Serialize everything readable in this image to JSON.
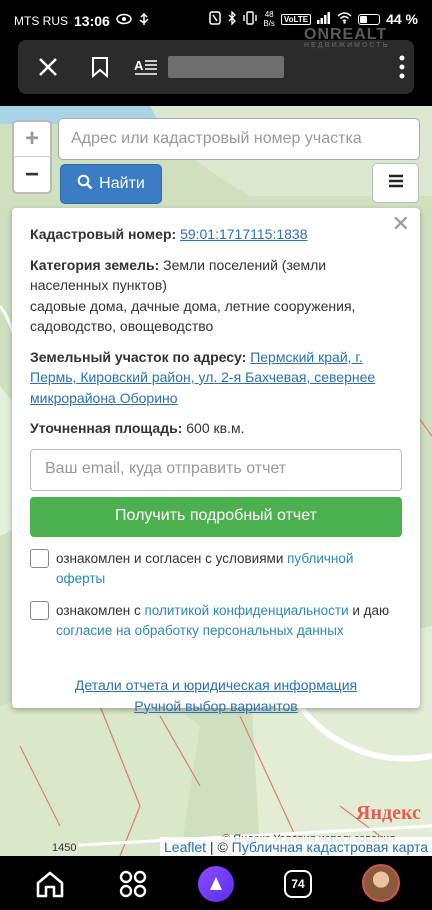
{
  "status_bar": {
    "carrier": "MTS RUS",
    "time": "13:06",
    "net_speed_value": "48",
    "net_speed_unit": "B/s",
    "battery": "44 %",
    "battery_level": 0.44
  },
  "browser": {
    "watermark": "ONREALT",
    "watermark_sub": "НЕДВИЖИМОСТЬ"
  },
  "map": {
    "search_placeholder": "Адрес или кадастровый номер участка",
    "find_button": "Найти",
    "zoom_in": "+",
    "zoom_out": "−"
  },
  "popup": {
    "cadastral_label": "Кадастровый номер:",
    "cadastral_number": "59:01:1717115:1838",
    "category_label": "Категория земель:",
    "category_value": "Земли поселений (земли населенных пунктов)",
    "category_use": "садовые дома, дачные дома, летние сооружения, садоводство, овощеводство",
    "address_label": "Земельный участок по адресу:",
    "address_value": "Пермский край, г. Пермь, Кировский район, ул. 2-я Бахчевая, севернее микрорайона Оборино",
    "area_label": "Уточненная площадь:",
    "area_value": "600 кв.м.",
    "email_placeholder": "Ваш email, куда отправить отчет",
    "get_report_button": "Получить подробный отчет",
    "consent1_text": "ознакомлен и согласен с условиями ",
    "consent1_link": "публичной оферты",
    "consent2_text1": "ознакомлен с ",
    "consent2_link1": "политикой конфиденциальности",
    "consent2_text2": " и даю ",
    "consent2_link2": "согласие на обработку персональных данных",
    "details_link": "Детали отчета и юридическая информация",
    "manual_link": "Ручной выбор вариантов"
  },
  "map_footer": {
    "yandex_logo": "Яндекс",
    "yandex_terms": "© Яндекс  Условия использования",
    "road_number": "1450",
    "leaflet_link": "Leaflet",
    "separator": " | © ",
    "pkk_link": "Публичная кадастровая карта"
  },
  "bottom_nav": {
    "tabs_count": "74"
  }
}
